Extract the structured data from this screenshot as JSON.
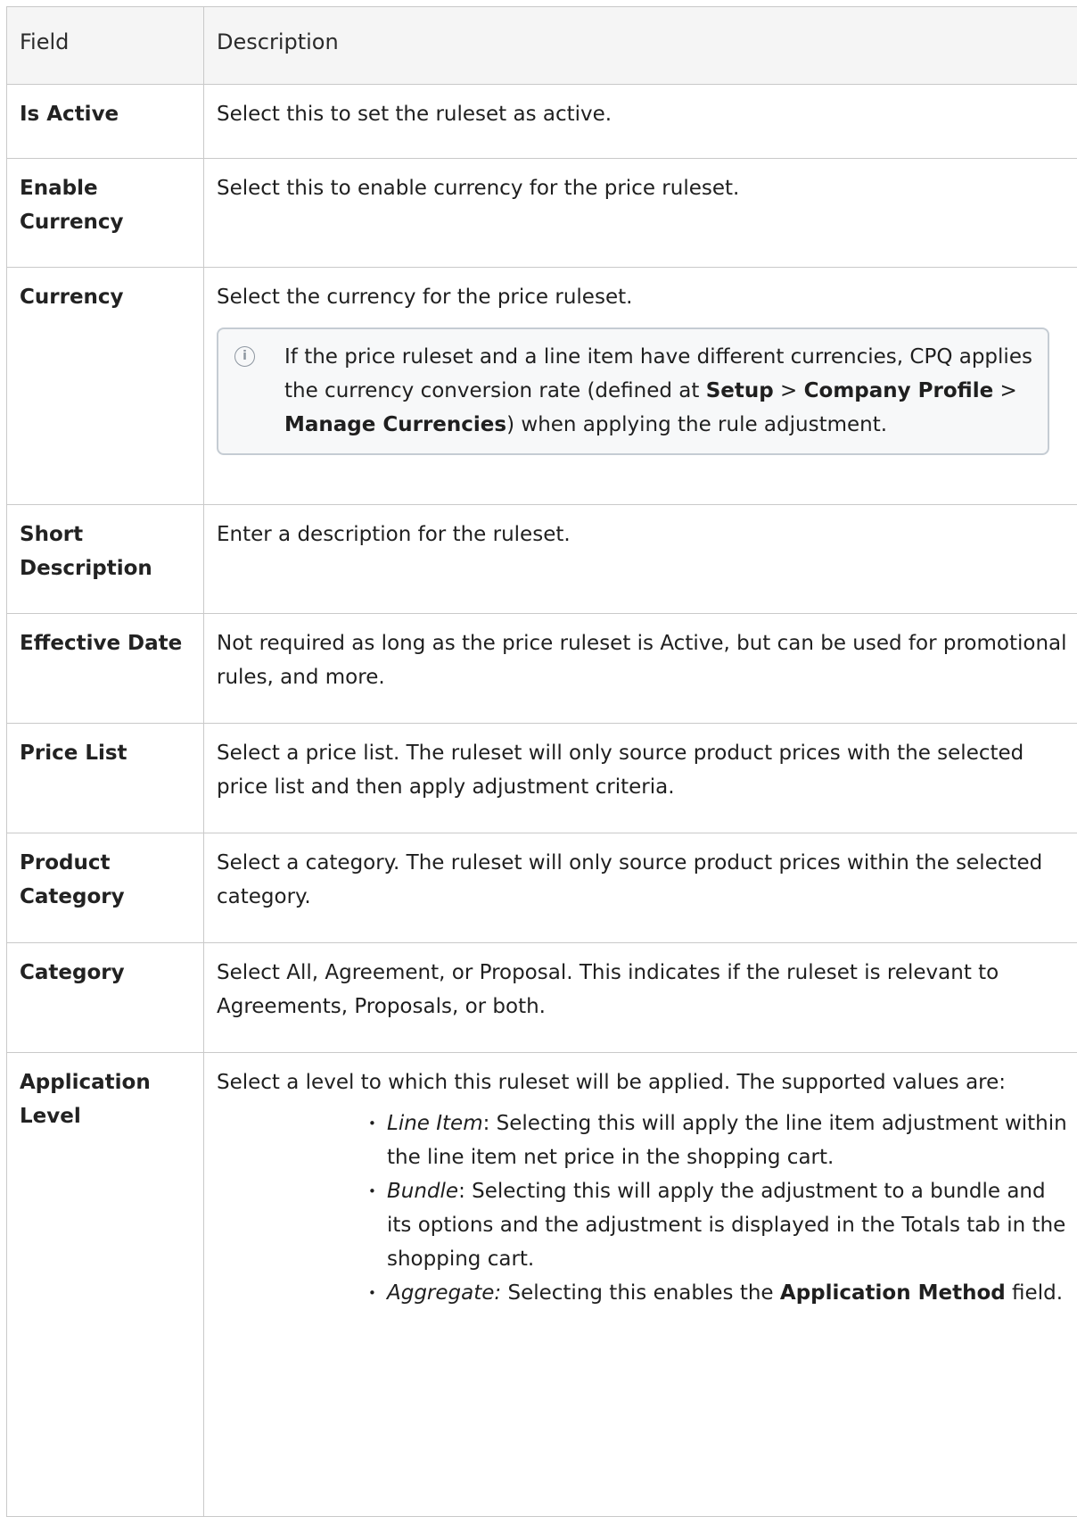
{
  "table": {
    "headers": {
      "field": "Field",
      "description": "Description"
    },
    "rows": {
      "is_active": {
        "field": "Is Active",
        "description": "Select this to set the ruleset as active."
      },
      "enable_currency": {
        "field": "Enable Currency",
        "description": "Select this to enable currency for the price ruleset."
      },
      "currency": {
        "field": "Currency",
        "description": "Select the currency for the price ruleset.",
        "note": {
          "icon": "info-icon",
          "text_1": "If the price ruleset and a line item have different currencies, CPQ applies the currency conversion rate (defined at ",
          "setup": "Setup",
          "sep_1": " > ",
          "company_profile": "Company Profile",
          "sep_2": " > ",
          "manage_currencies": "Manage Currencies",
          "text_2": ") when applying the rule adjustment."
        }
      },
      "short_description": {
        "field": "Short Description",
        "description": "Enter a description for the ruleset."
      },
      "effective_date": {
        "field": "Effective Date",
        "description": "Not required as long as the price ruleset is Active, but can be used for promotional rules, and more."
      },
      "price_list": {
        "field": "Price List",
        "description": "Select a price list. The ruleset will only source product prices with the selected price list and then apply adjustment criteria."
      },
      "product_category": {
        "field": "Product Category",
        "description": "Select a category. The ruleset will only source product prices within the selected category."
      },
      "category": {
        "field": "Category",
        "description": "Select All, Agreement, or Proposal. This indicates if the ruleset is relevant to Agreements, Proposals, or both."
      },
      "application_level": {
        "field": "Application Level",
        "description": "Select a level to which this ruleset will be applied. The supported values are:",
        "items": {
          "line_item": {
            "term": "Line Item",
            "text": ": Selecting this will apply the line item adjustment within the line item net price in the shopping cart."
          },
          "bundle": {
            "term": "Bundle",
            "text": ": Selecting this will apply the adjustment to a bundle and its options and the adjustment is displayed in the Totals tab in the shopping cart."
          },
          "aggregate": {
            "term": "Aggregate:",
            "text_1": " Selecting this enables the ",
            "bold": "Application Method",
            "text_2": " field."
          }
        }
      }
    }
  }
}
